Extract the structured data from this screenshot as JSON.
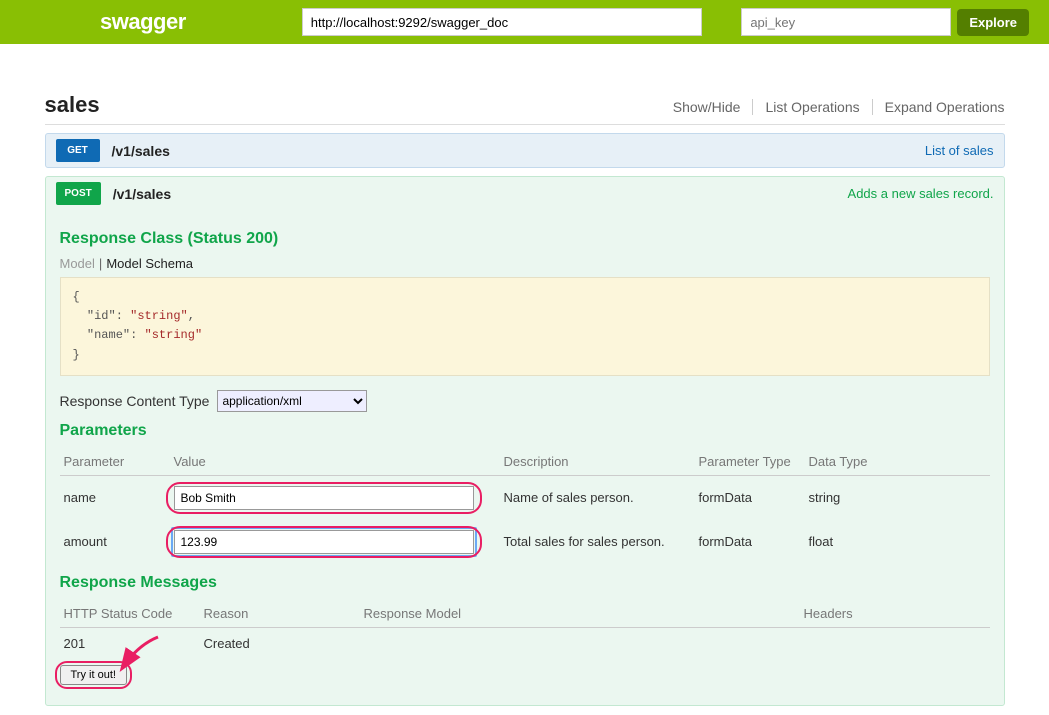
{
  "header": {
    "logo": "swagger",
    "url": "http://localhost:9292/swagger_doc",
    "apikey_placeholder": "api_key",
    "explore": "Explore"
  },
  "resource": {
    "name": "sales",
    "links": {
      "showhide": "Show/Hide",
      "list": "List Operations",
      "expand": "Expand Operations"
    }
  },
  "ops": {
    "get": {
      "method": "GET",
      "path": "/v1/sales",
      "summary": "List of sales"
    },
    "post": {
      "method": "POST",
      "path": "/v1/sales",
      "summary": "Adds a new sales record.",
      "response_class_title": "Response Class (Status 200)",
      "model_tab": "Model",
      "schema_tab": "Model Schema",
      "schema": "{\n  \"id\": \"string\",\n  \"name\": \"string\"\n}",
      "schema_keys": {
        "id": "id",
        "name": "name",
        "val": "string"
      },
      "content_type_label": "Response Content Type",
      "content_type_value": "application/xml",
      "params_title": "Parameters",
      "params_headers": {
        "parameter": "Parameter",
        "value": "Value",
        "description": "Description",
        "ptype": "Parameter Type",
        "dtype": "Data Type"
      },
      "params": [
        {
          "name": "name",
          "value": "Bob Smith",
          "desc": "Name of sales person.",
          "ptype": "formData",
          "dtype": "string"
        },
        {
          "name": "amount",
          "value": "123.99",
          "desc": "Total sales for sales person.",
          "ptype": "formData",
          "dtype": "float"
        }
      ],
      "resp_title": "Response Messages",
      "resp_headers": {
        "code": "HTTP Status Code",
        "reason": "Reason",
        "model": "Response Model",
        "headers": "Headers"
      },
      "resp_rows": [
        {
          "code": "201",
          "reason": "Created"
        }
      ],
      "try": "Try it out!"
    }
  }
}
